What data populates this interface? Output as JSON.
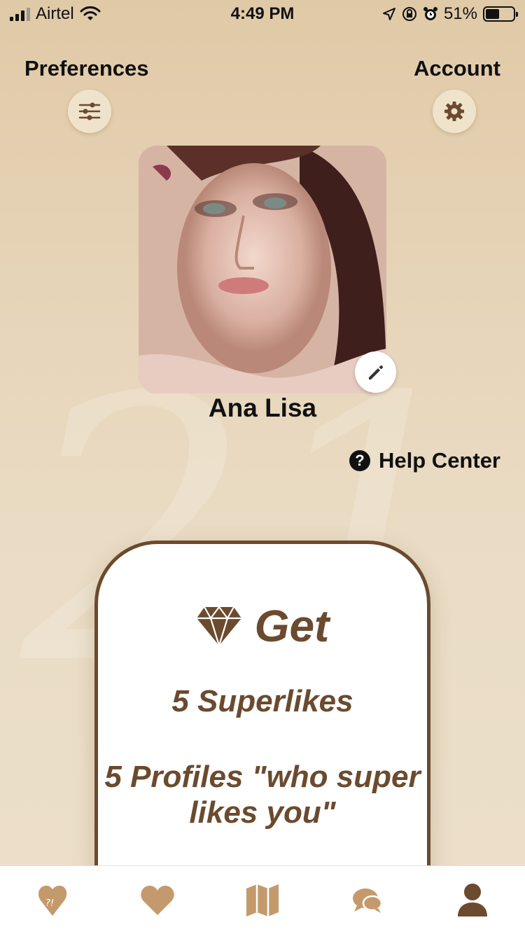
{
  "status_bar": {
    "carrier": "Airtel",
    "time": "4:49 PM",
    "battery": "51%",
    "battery_level": 0.51
  },
  "header": {
    "preferences_label": "Preferences",
    "account_label": "Account",
    "preferences_icon": "sliders-icon",
    "account_icon": "gear-icon"
  },
  "profile": {
    "name": "Ana Lisa",
    "edit_icon": "pencil-icon"
  },
  "help": {
    "label": "Help Center",
    "icon": "question-icon",
    "icon_glyph": "?"
  },
  "promo": {
    "title": "Get",
    "line1": "5 Superlikes",
    "line2": "5 Profiles \"who super likes you\"",
    "icon": "diamond-icon"
  },
  "nav": {
    "items": [
      {
        "name": "broken-heart-icon",
        "active": false
      },
      {
        "name": "heart-icon",
        "active": false
      },
      {
        "name": "map-icon",
        "active": false
      },
      {
        "name": "chat-icon",
        "active": false
      },
      {
        "name": "profile-icon",
        "active": true
      }
    ]
  },
  "colors": {
    "accent": "#6b4a2e",
    "nav_icon": "#c49a6c",
    "nav_active": "#6b4a2e",
    "background": "#e6d4b8"
  }
}
